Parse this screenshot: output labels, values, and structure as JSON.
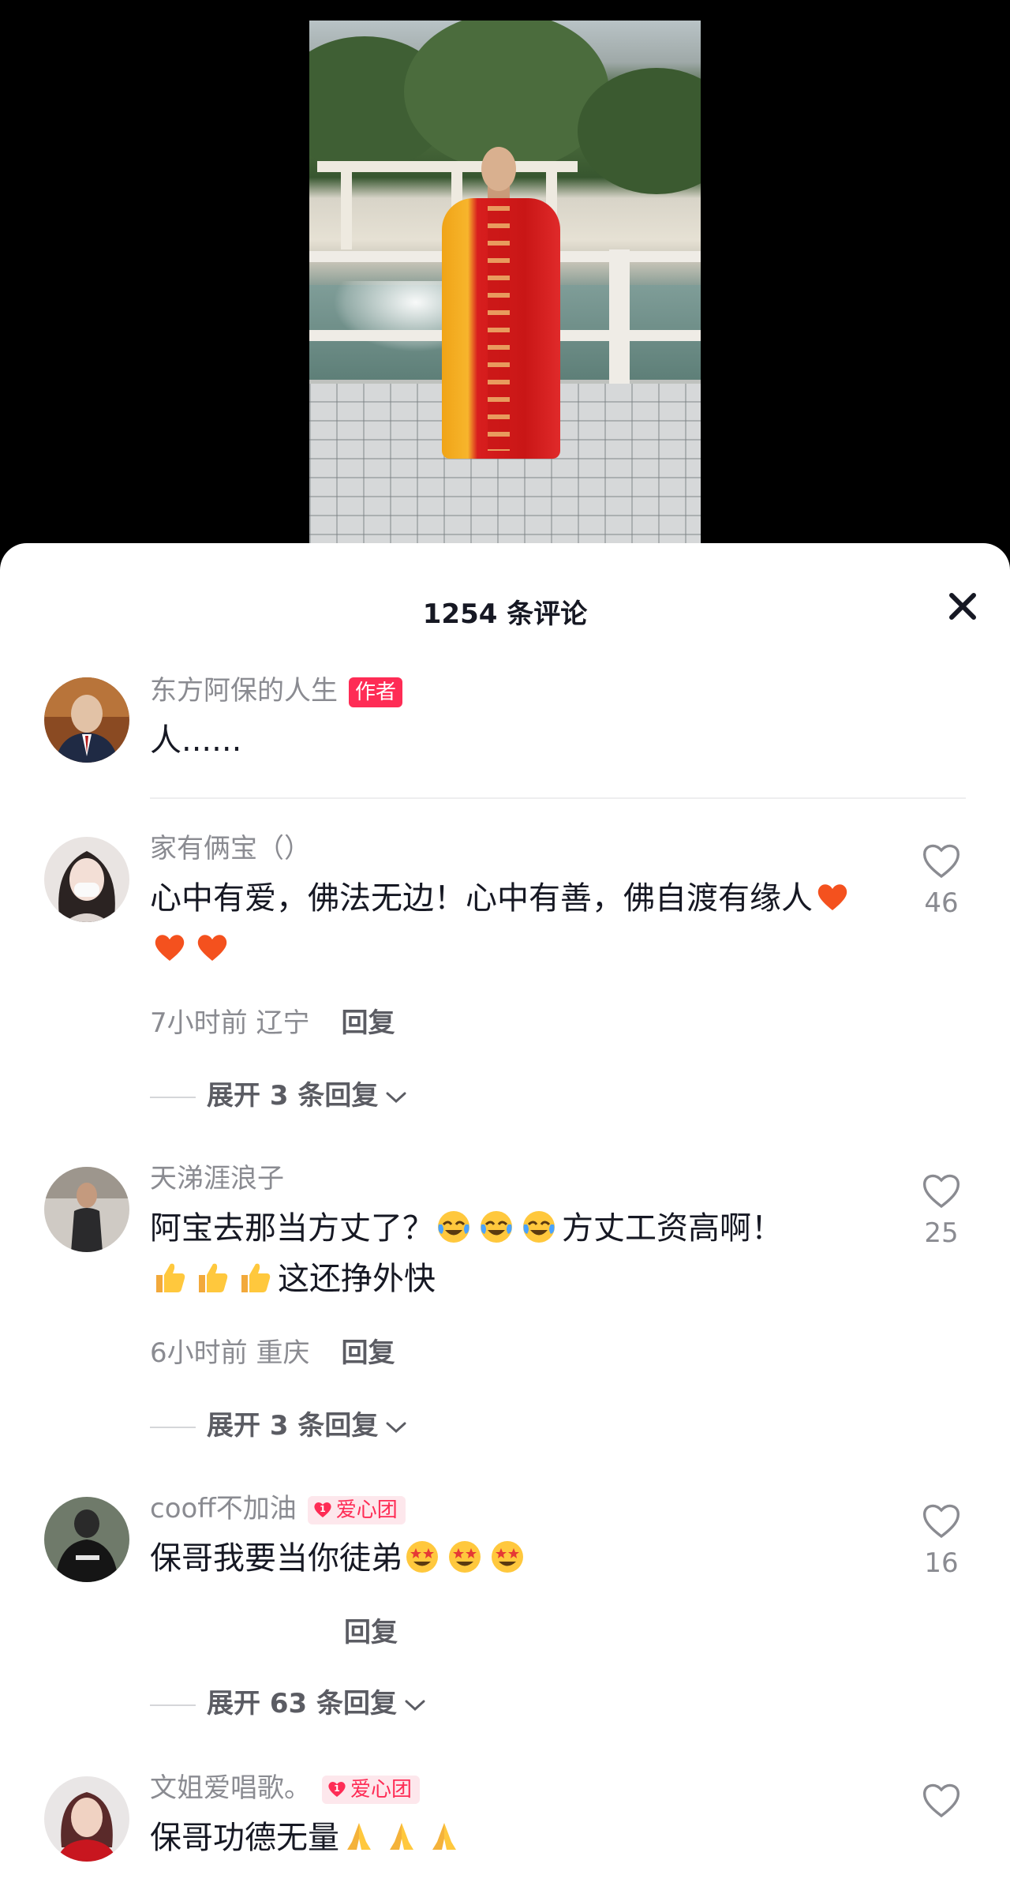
{
  "header": {
    "title": "1254 条评论"
  },
  "comments": [
    {
      "username": "东方阿保的人生",
      "badge": "作者",
      "text": "人......"
    },
    {
      "username": "家有俩宝（）",
      "text": "心中有爱，佛法无边！心中有善，佛自渡有缘人",
      "emojis": [
        "heart-emoji",
        "heart-emoji",
        "heart-emoji"
      ],
      "time": "7小时前 辽宁",
      "reply_label": "回复",
      "expand_label": "展开 3 条回复",
      "likes": "46"
    },
    {
      "username": "天涕涯浪子",
      "text_before": "阿宝去那当方丈了？",
      "text_middle": "方丈工资高啊！",
      "text_after": "这还挣外快",
      "emojis_a": [
        "crying-laughing-emoji",
        "crying-laughing-emoji",
        "crying-laughing-emoji"
      ],
      "emojis_b": [
        "thumbs-up-emoji",
        "thumbs-up-emoji",
        "thumbs-up-emoji"
      ],
      "time": "6小时前 重庆",
      "reply_label": "回复",
      "expand_label": "展开 3 条回复",
      "likes": "25"
    },
    {
      "username": "cooff不加油",
      "badge": "爱心团",
      "badge_level": "1",
      "text": "保哥我要当你徒弟",
      "emojis": [
        "star-eyes-emoji",
        "star-eyes-emoji",
        "star-eyes-emoji"
      ],
      "reply_label": "回复",
      "expand_label": "展开 63 条回复",
      "likes": "16"
    },
    {
      "username": "文姐爱唱歌。",
      "badge": "爱心团",
      "badge_level": "1",
      "text": "保哥功德无量",
      "emojis": [
        "pray-emoji",
        "pray-emoji",
        "pray-emoji"
      ]
    }
  ],
  "colors": {
    "brand_red": "#fe2c55",
    "text_primary": "#161823",
    "text_secondary": "#8a8b91"
  }
}
